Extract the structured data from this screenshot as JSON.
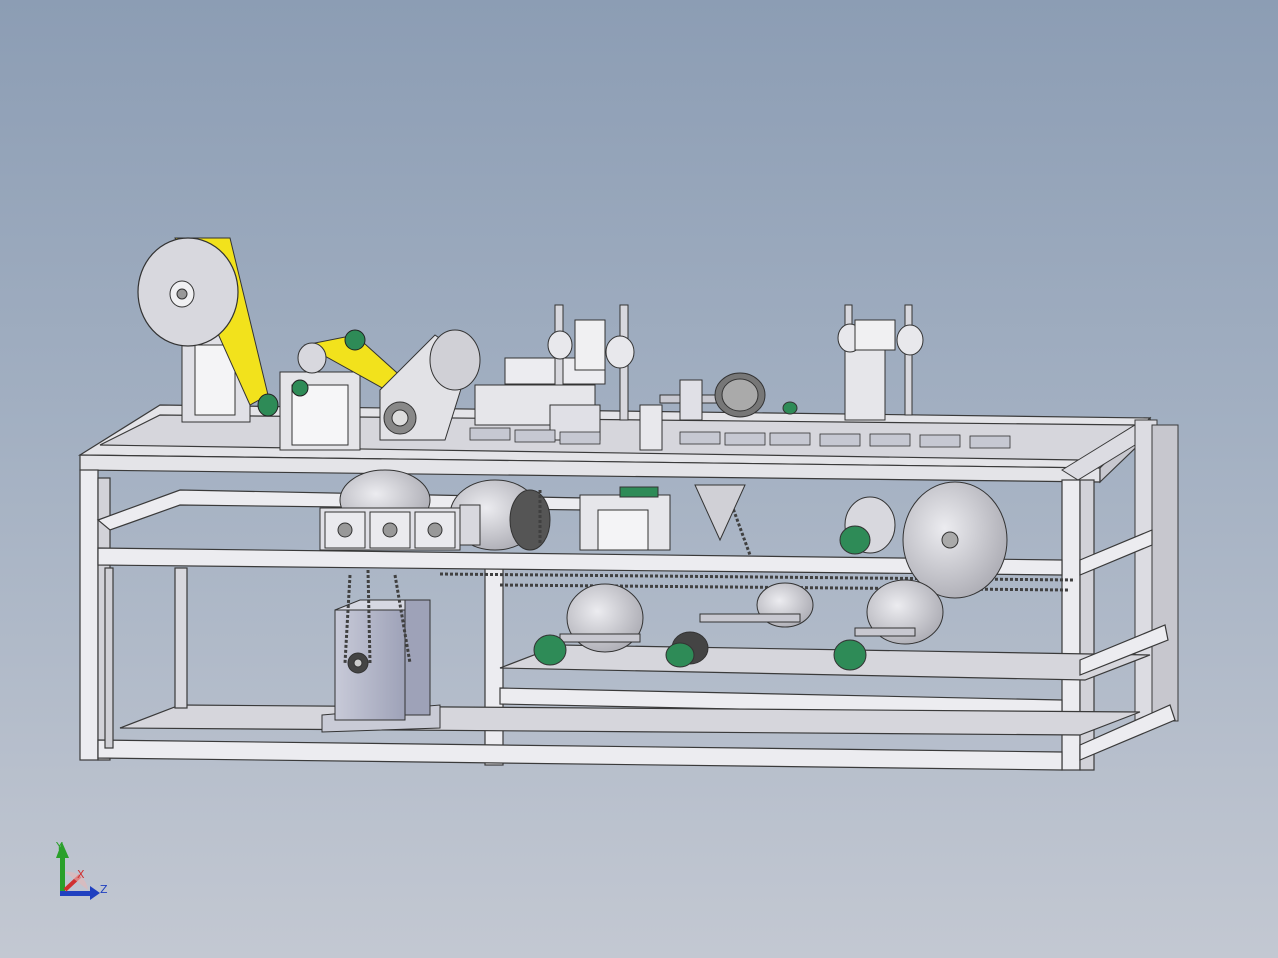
{
  "triad": {
    "y_label": "Y",
    "x_label": "X",
    "z_label": "Z"
  },
  "colors": {
    "background_top": "#8c9db4",
    "background_bottom": "#c3c8d2",
    "frame": "#e6e6ea",
    "frame_edge": "#3a3a3a",
    "belt": "#f2e21c",
    "bearing": "#2e8b57",
    "chain": "#404040",
    "axis_y": "#2aa02a",
    "axis_x": "#d03030",
    "axis_z": "#2040c0"
  }
}
